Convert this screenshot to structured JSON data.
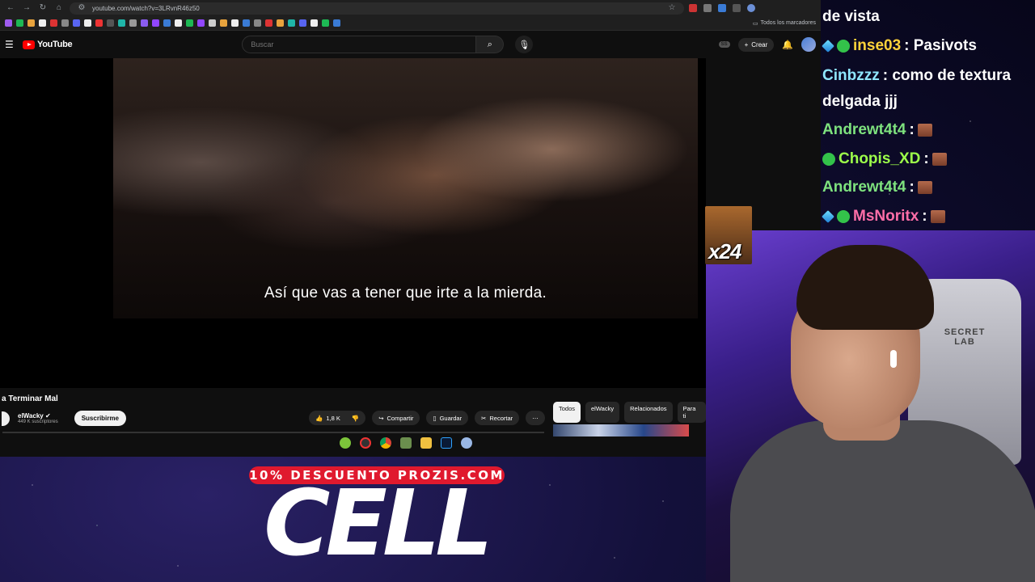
{
  "browser": {
    "url": "youtube.com/watch?v=3LRvnR46z50",
    "bookmarks_all": "Todos los marcadores"
  },
  "youtube": {
    "brand": "YouTube",
    "search_placeholder": "Buscar",
    "create_label": "Crear"
  },
  "video": {
    "subtitle": "Así que vas a tener que irte a la mierda.",
    "title_fragment": "a Terminar Mal",
    "channel": "elWacky",
    "subscribers": "449 K suscriptores",
    "subscribe_label": "Suscribirme",
    "likes": "1,8 K",
    "share_label": "Compartir",
    "save_label": "Guardar",
    "clip_label": "Recortar"
  },
  "chips": [
    "Todos",
    "elWacky",
    "Relacionados",
    "Para ti"
  ],
  "promo": {
    "discount": "10% DESCUENTO PROZIS.COM",
    "code": "CELL"
  },
  "chat": {
    "lines": [
      {
        "user": "",
        "text": "de vista",
        "color": "#ffffff"
      },
      {
        "user": "inse03",
        "text": ": Pasivots",
        "color": "#ffd23a"
      },
      {
        "user": "Cinbzzz",
        "text": ": como de textura",
        "color": "#8fe6ff"
      },
      {
        "user": "",
        "text": "delgada jjj",
        "color": "#ffffff"
      },
      {
        "user": "Andrewt4t4",
        "text": ":",
        "color": "#7ee27e"
      },
      {
        "user": "Chopis_XD",
        "text": ":",
        "color": "#9dff4a"
      },
      {
        "user": "Andrewt4t4",
        "text": ":",
        "color": "#7ee27e"
      },
      {
        "user": "MsNoritx",
        "text": ":",
        "color": "#ff6ea8"
      }
    ]
  },
  "overlay": {
    "multiplier": "x24"
  },
  "webcam": {
    "chair_brand": "SECRET LAB"
  }
}
